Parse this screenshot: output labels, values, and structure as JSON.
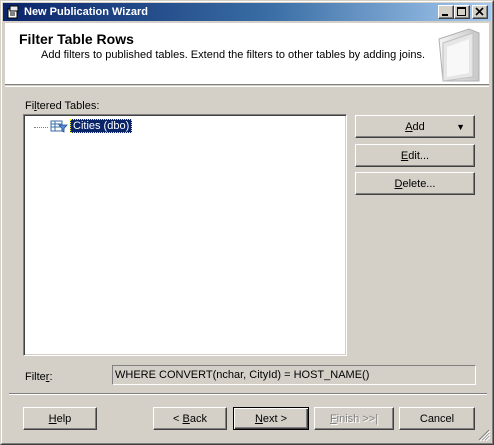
{
  "window": {
    "title": "New Publication Wizard",
    "minimize_label": "_",
    "maximize_label": "□",
    "close_label": "×"
  },
  "header": {
    "title": "Filter Table Rows",
    "description": "Add filters to published tables. Extend the filters to other tables by adding joins."
  },
  "filtered_tables": {
    "label_prefix": "Fi",
    "label_underline": "l",
    "label_suffix": "tered Tables:",
    "items": [
      {
        "label": "Cities (dbo)",
        "selected": true
      }
    ]
  },
  "side_buttons": {
    "add": {
      "u": "A",
      "rest": "dd"
    },
    "edit": {
      "u": "E",
      "rest": "dit..."
    },
    "delete": {
      "u": "D",
      "rest": "elete..."
    }
  },
  "filter": {
    "label_prefix": "Filte",
    "label_underline": "r",
    "label_suffix": ":",
    "value": "WHERE CONVERT(nchar, CityId) = HOST_NAME()"
  },
  "nav_buttons": {
    "help": {
      "u": "H",
      "rest": "elp"
    },
    "back": {
      "prefix": "< ",
      "u": "B",
      "rest": "ack"
    },
    "next": {
      "u": "N",
      "rest": "ext >"
    },
    "finish": {
      "u": "F",
      "rest": "inish >>|"
    },
    "cancel": {
      "label": "Cancel"
    }
  },
  "colors": {
    "title_gradient_start": "#0a246a",
    "title_gradient_end": "#a6caf0",
    "face": "#d4d0c8",
    "selection": "#0a246a"
  }
}
